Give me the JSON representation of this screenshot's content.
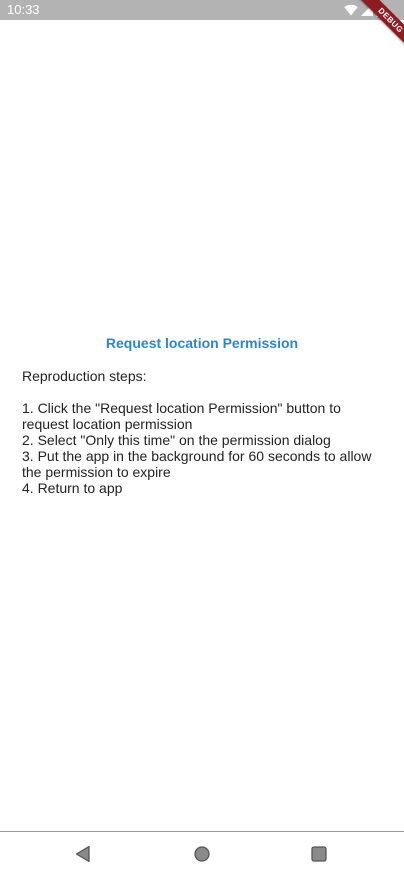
{
  "status_bar": {
    "time": "10:33"
  },
  "debug_banner": {
    "label": "DEBUG"
  },
  "main": {
    "request_button_label": "Request location Permission",
    "steps_heading": "Reproduction steps:",
    "steps": [
      "1. Click the \"Request location Permission\" button to request location permission",
      "2. Select \"Only this time\" on the permission dialog",
      "3. Put the app in the background for 60 seconds to allow the permission to expire",
      "4. Return to app"
    ]
  },
  "colors": {
    "accent": "#2e86c8",
    "status_bar": "#b3b3b3",
    "debug_banner": "#8e1c23"
  },
  "nav_bar": {
    "icons": [
      "back-icon",
      "home-icon",
      "recents-icon"
    ]
  }
}
